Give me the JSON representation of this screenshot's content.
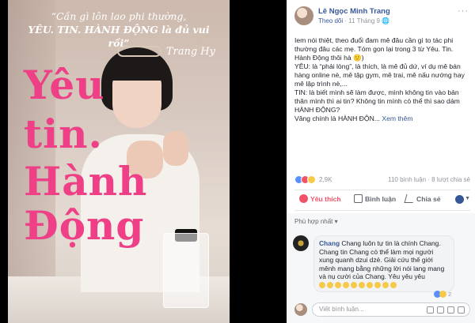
{
  "photo": {
    "quote_line1": "“Cần gì lôn lao phi thường,",
    "quote_line2": "YÊU. TIN. HÀNH ĐỘNG là đủ vui rồi”",
    "signature": "Trang Hy",
    "words": [
      "YÊU.",
      "TIN.",
      "HÀNH",
      "ĐỘNG",
      ""
    ],
    "big_lines": [
      "Yêu",
      "tin.",
      "Hành",
      "Động"
    ],
    "accent_color": "#ef3f86"
  },
  "post": {
    "author": "Lê Ngọc Minh Trang",
    "follow_label": "Theo dõi",
    "date": "11 Tháng 9",
    "more_label": "···",
    "body": [
      "Iem nói thiệt, theo đuổi đam mê đâu cần gì to tác phi thường đâu các mẹ. Tóm gọn lại trong 3 từ Yêu. Tin. Hành Động thôi hà 🙂)",
      "YÊU: là “phải lòng”, là thích, là mê đủ dứ, ví dụ mê bán hàng online nè, mê tập gym, mê trai, mê nấu nướng hay mê lập trình nè,...",
      "TIN: là biết mình sẽ làm được, mình không tin vào bản thân mình thì ai tin? Không tin mình có thể thì sao dám HÀNH ĐỘNG?",
      "Vâng chính là HÀNH ĐỘN..."
    ],
    "see_more": "Xem thêm",
    "reaction_count": "2,9K",
    "comments_count": "110 bình luận",
    "shares_count": "8 lượt chia sẻ",
    "actions": {
      "like": "Yêu thích",
      "comment": "Bình luận",
      "share": "Chia sẻ"
    },
    "comment_filter": "Phù hợp nhất ▾",
    "comment": {
      "author": "Chang",
      "text": " Chang luôn tự tin là chính Chang. Chang tin Chang có thể làm mọi người xung quanh dzui dzẻ. Giải cứu thế giới mênh mang bằng những lời nói lang mang và nụ cười của Chang. Yêu yêu yêu",
      "reaction_count": "2"
    },
    "write_placeholder": "Viết bình luận..."
  }
}
